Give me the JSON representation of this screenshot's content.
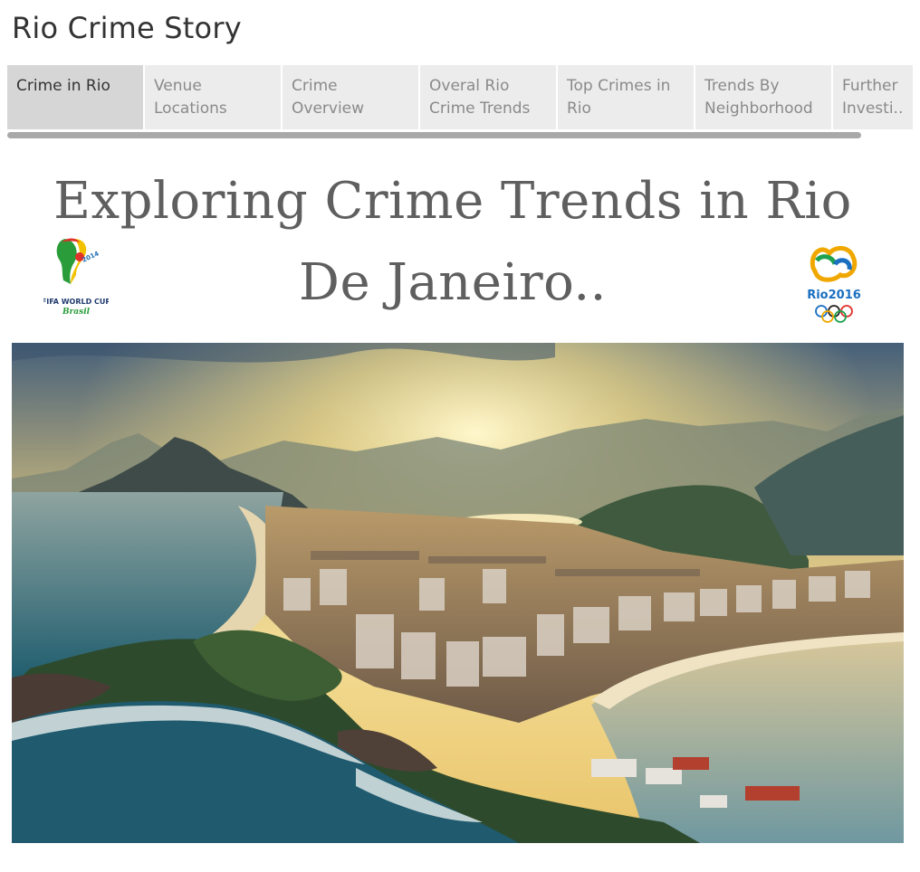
{
  "story": {
    "title": "Rio Crime Story"
  },
  "tabs": [
    {
      "label": "Crime in Rio",
      "active": true
    },
    {
      "label": "Venue\nLocations",
      "active": false
    },
    {
      "label": "Crime\nOverview",
      "active": false
    },
    {
      "label": "Overal Rio\nCrime Trends",
      "active": false
    },
    {
      "label": "Top Crimes in\nRio",
      "active": false
    },
    {
      "label": "Trends By\nNeighborhood",
      "active": false
    },
    {
      "label": "Further\nInvesti..",
      "active": false
    }
  ],
  "dashboard": {
    "heading_line1": "Exploring Crime Trends in Rio",
    "heading_line2": "De Janeiro.."
  },
  "logos": {
    "world_cup": {
      "icon": "fifa-world-cup-2014-logo",
      "text": "FIFA WORLD CUP",
      "subtext": "Brasil"
    },
    "olympics": {
      "icon": "rio-2016-olympics-logo",
      "text": "Rio2016"
    }
  },
  "image": {
    "subject": "aerial-photo-rio-de-janeiro-copacabana"
  },
  "colors": {
    "tab_active_bg": "#d6d6d6",
    "tab_bg": "#ececec",
    "tab_text": "#8a8a8a",
    "heading_text": "#5f5f5f"
  }
}
